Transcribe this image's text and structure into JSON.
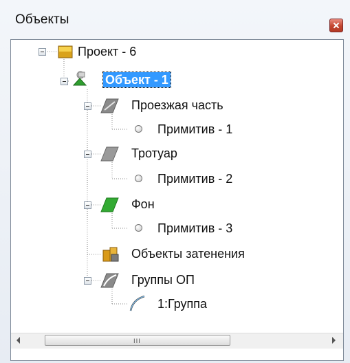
{
  "window": {
    "title": "Объекты",
    "close_icon": "close-icon"
  },
  "tree": {
    "project": {
      "label": "Проект - 6",
      "icon": "project-folder-icon"
    },
    "object": {
      "label": "Объект - 1",
      "icon": "object-icon",
      "selected": true
    },
    "roadway": {
      "label": "Проезжая часть",
      "icon": "roadway-surface-icon"
    },
    "roadway_primitive": {
      "label": "Примитив - 1",
      "icon": "primitive-icon"
    },
    "sidewalk": {
      "label": "Тротуар",
      "icon": "sidewalk-surface-icon"
    },
    "sidewalk_primitive": {
      "label": "Примитив - 2",
      "icon": "primitive-icon"
    },
    "background": {
      "label": "Фон",
      "icon": "background-surface-icon"
    },
    "background_primitive": {
      "label": "Примитив - 3",
      "icon": "primitive-icon"
    },
    "shading_objects": {
      "label": "Объекты затенения",
      "icon": "shading-objects-icon"
    },
    "op_groups": {
      "label": "Группы ОП",
      "icon": "op-groups-icon"
    },
    "group1": {
      "label": "1:Группа",
      "icon": "group-icon"
    }
  },
  "colors": {
    "selection": "#3399ff",
    "close_button": "#c2452f",
    "background_green": "#33aa33"
  },
  "scrollbar": {
    "grip": "III"
  }
}
